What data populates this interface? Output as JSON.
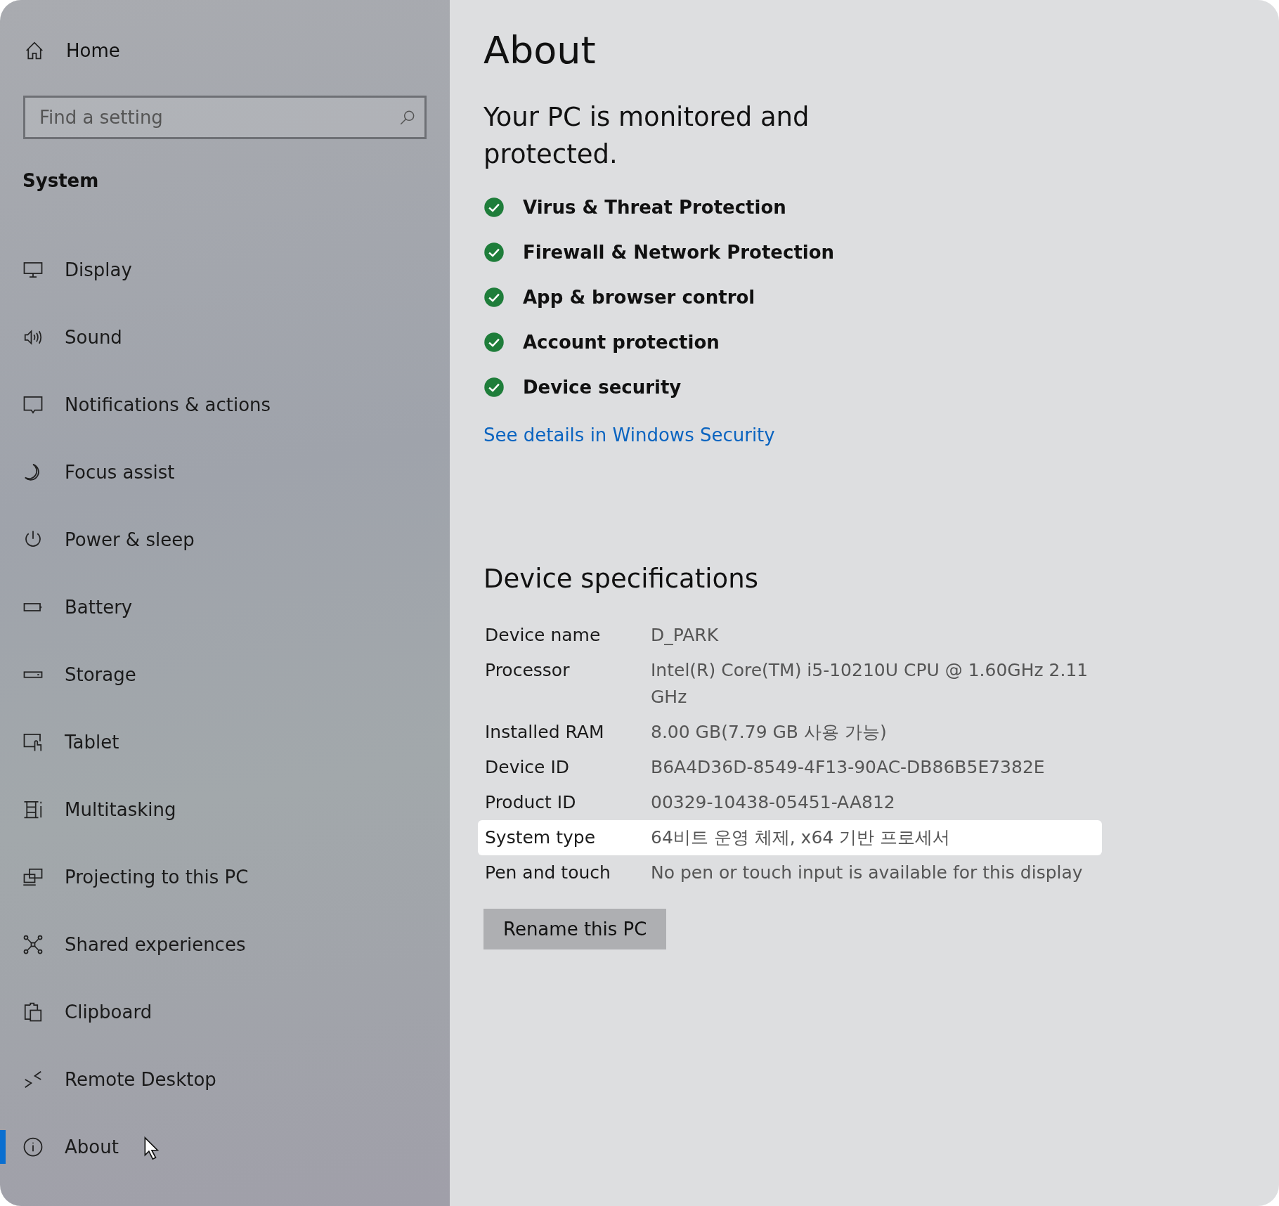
{
  "sidebar": {
    "home": "Home",
    "search": {
      "placeholder": "Find a setting"
    },
    "section": "System",
    "items": [
      {
        "label": "Display",
        "selected": false
      },
      {
        "label": "Sound",
        "selected": false
      },
      {
        "label": "Notifications & actions",
        "selected": false
      },
      {
        "label": "Focus assist",
        "selected": false
      },
      {
        "label": "Power & sleep",
        "selected": false
      },
      {
        "label": "Battery",
        "selected": false
      },
      {
        "label": "Storage",
        "selected": false
      },
      {
        "label": "Tablet",
        "selected": false
      },
      {
        "label": "Multitasking",
        "selected": false
      },
      {
        "label": "Projecting to this PC",
        "selected": false
      },
      {
        "label": "Shared experiences",
        "selected": false
      },
      {
        "label": "Clipboard",
        "selected": false
      },
      {
        "label": "Remote Desktop",
        "selected": false
      },
      {
        "label": "About",
        "selected": true
      }
    ]
  },
  "main": {
    "title": "About",
    "security": {
      "heading": "Your PC is monitored and protected.",
      "items": [
        "Virus & Threat Protection",
        "Firewall & Network Protection",
        "App & browser control",
        "Account protection",
        "Device security"
      ],
      "link": "See details in Windows Security"
    },
    "specs": {
      "heading": "Device specifications",
      "rows": [
        {
          "label": "Device name",
          "value": "D_PARK",
          "highlighted": false
        },
        {
          "label": "Processor",
          "value": "Intel(R) Core(TM) i5-10210U CPU @ 1.60GHz   2.11 GHz",
          "highlighted": false
        },
        {
          "label": "Installed RAM",
          "value": "8.00 GB(7.79 GB 사용 가능)",
          "highlighted": false
        },
        {
          "label": "Device ID",
          "value": "B6A4D36D-8549-4F13-90AC-DB86B5E7382E",
          "highlighted": false
        },
        {
          "label": "Product ID",
          "value": "00329-10438-05451-AA812",
          "highlighted": false
        },
        {
          "label": "System type",
          "value": "64비트 운영 체제, x64 기반 프로세서",
          "highlighted": true
        },
        {
          "label": "Pen and touch",
          "value": "No pen or touch input is available for this display",
          "highlighted": false
        }
      ],
      "button": "Rename this PC"
    }
  }
}
